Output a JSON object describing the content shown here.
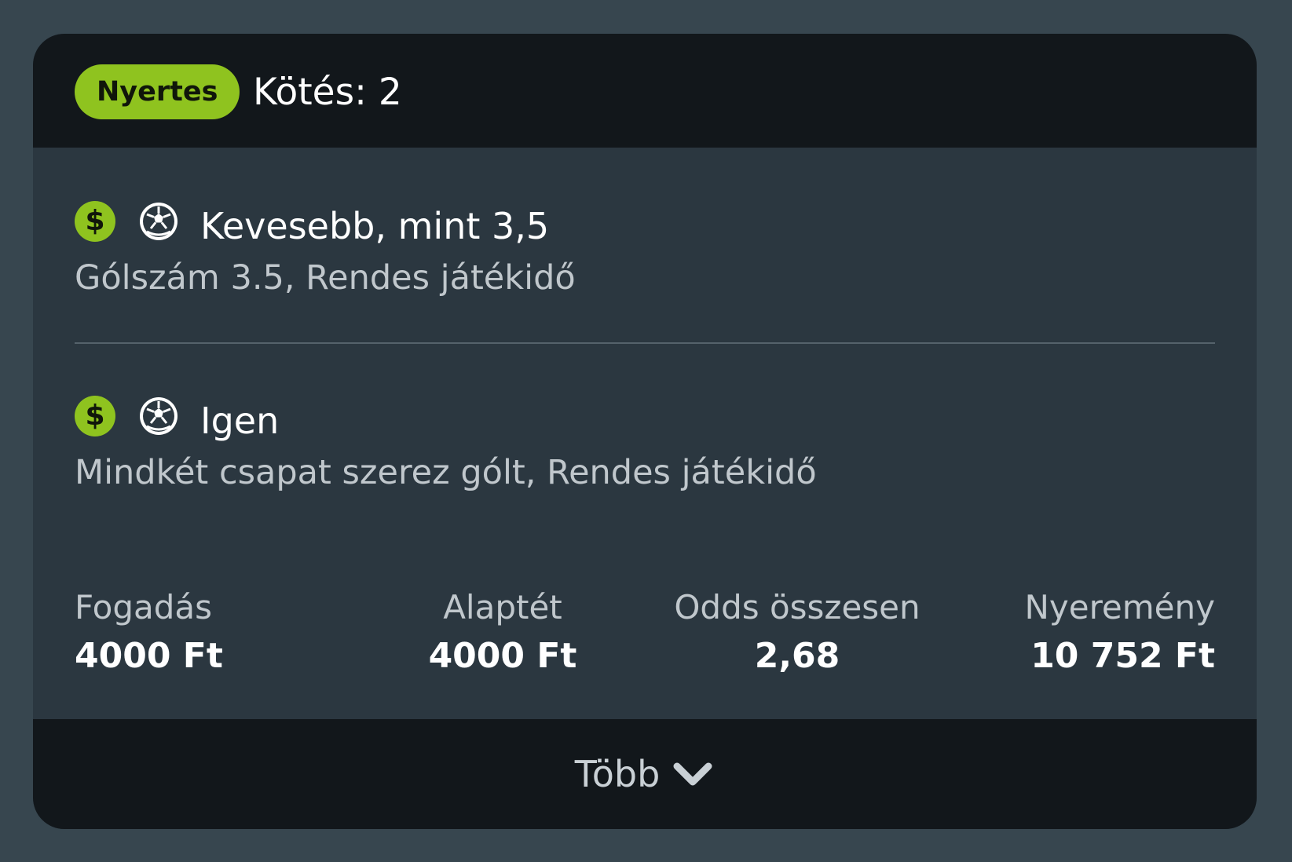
{
  "header": {
    "badge": "Nyertes",
    "title": "Kötés: 2"
  },
  "selections": [
    {
      "icon_status": "dollar-icon",
      "icon_sport": "soccer-ball-icon",
      "dollar_symbol": "$",
      "name": "Kevesebb, mint 3,5",
      "market": "Gólszám 3.5, Rendes játékidő"
    },
    {
      "icon_status": "dollar-icon",
      "icon_sport": "soccer-ball-icon",
      "dollar_symbol": "$",
      "name": "Igen",
      "market": "Mindkét csapat szerez gólt, Rendes játékidő"
    }
  ],
  "summary": {
    "fogadas_label": "Fogadás",
    "fogadas_value": "4000 Ft",
    "alaptet_label": "Alaptét",
    "alaptet_value": "4000 Ft",
    "odds_label": "Odds összesen",
    "odds_value": "2,68",
    "nyeremeny_label": "Nyeremény",
    "nyeremeny_value": "10 752 Ft"
  },
  "footer": {
    "more_label": "Több"
  },
  "colors": {
    "accent_green": "#8fc31f",
    "card_bg": "#2b3740",
    "header_bg": "#12171b",
    "page_bg": "#37464f"
  }
}
